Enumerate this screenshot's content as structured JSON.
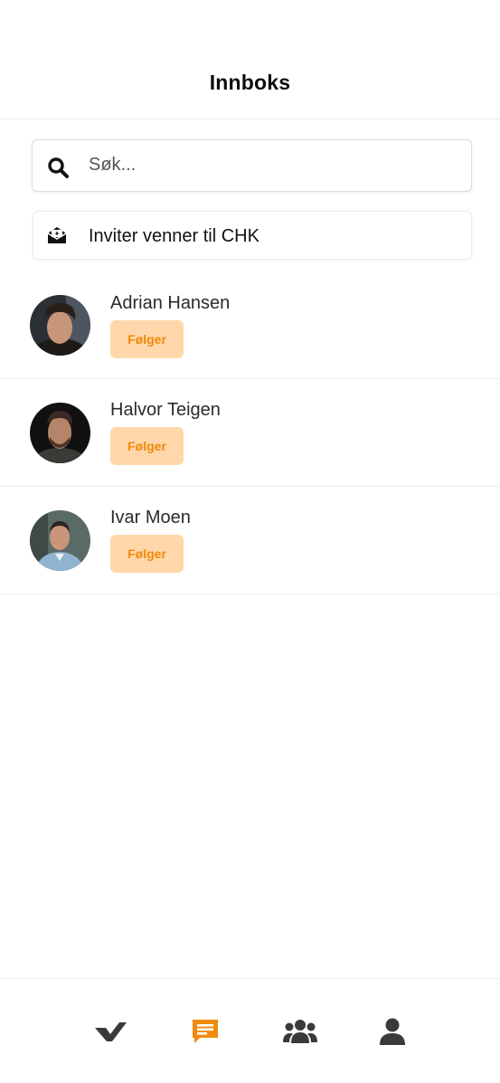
{
  "header": {
    "title": "Innboks"
  },
  "search": {
    "placeholder": "Søk..."
  },
  "invite": {
    "label": "Inviter venner til CHK"
  },
  "contacts": [
    {
      "name": "Adrian Hansen",
      "status": "Følger"
    },
    {
      "name": "Halvor Teigen",
      "status": "Følger"
    },
    {
      "name": "Ivar Moen",
      "status": "Følger"
    }
  ],
  "tabbar": {
    "active_index": 1,
    "items": [
      {
        "icon": "check-logo-icon"
      },
      {
        "icon": "chat-icon"
      },
      {
        "icon": "group-icon"
      },
      {
        "icon": "profile-icon"
      }
    ]
  },
  "colors": {
    "accent": "#f08a0c",
    "badge_bg": "#ffd7aa",
    "icon_dark": "#3a3a3a"
  }
}
